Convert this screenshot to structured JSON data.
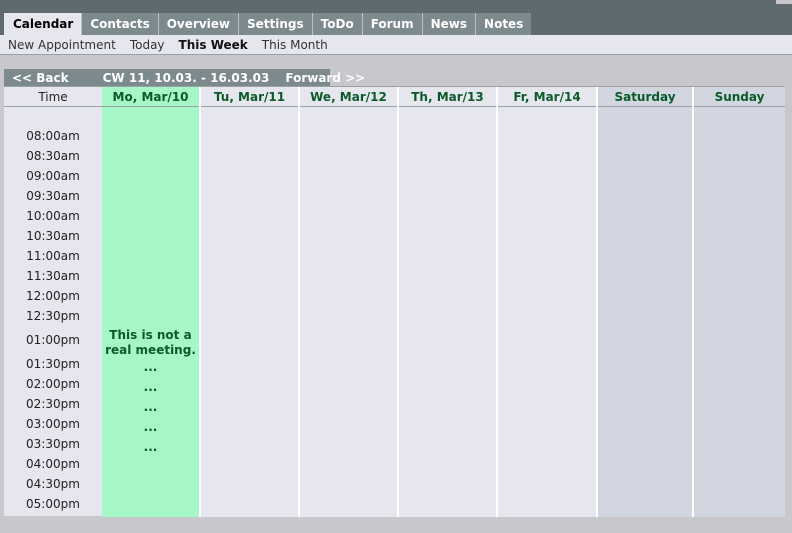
{
  "tabs": [
    {
      "label": "Calendar",
      "active": true
    },
    {
      "label": "Contacts"
    },
    {
      "label": "Overview"
    },
    {
      "label": "Settings"
    },
    {
      "label": "ToDo"
    },
    {
      "label": "Forum"
    },
    {
      "label": "News"
    },
    {
      "label": "Notes"
    }
  ],
  "subnav": [
    {
      "label": "New Appointment"
    },
    {
      "label": "Today"
    },
    {
      "label": "This Week",
      "active": true
    },
    {
      "label": "This Month"
    }
  ],
  "week_nav": {
    "back": "<< Back",
    "week": "CW 11,  10.03. - 16.03.03",
    "forward": "Forward >>"
  },
  "calendar": {
    "time_header": "Time",
    "days": [
      "Mo, Mar/10",
      "Tu, Mar/11",
      "We, Mar/12",
      "Th, Mar/13",
      "Fr, Mar/14",
      "Saturday",
      "Sunday"
    ],
    "times": [
      "08:00am",
      "08:30am",
      "09:00am",
      "09:30am",
      "10:00am",
      "10:30am",
      "11:00am",
      "11:30am",
      "12:00pm",
      "12:30pm",
      "01:00pm",
      "01:30pm",
      "02:00pm",
      "02:30pm",
      "03:00pm",
      "03:30pm",
      "04:00pm",
      "04:30pm",
      "05:00pm"
    ],
    "event": {
      "line1": "This is not a",
      "line2": "real meeting.",
      "continuation": "..."
    },
    "colors": {
      "today": "#a6f7c8",
      "weekday": "#e6e6ee",
      "weekend": "#d2d6e0",
      "header_text": "#0a5a2a"
    }
  }
}
